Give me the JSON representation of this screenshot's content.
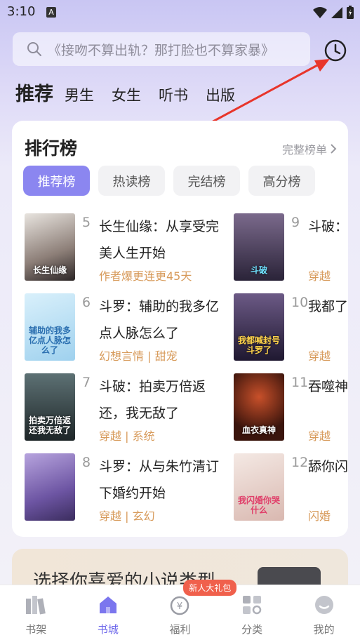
{
  "status": {
    "time": "3:10",
    "a_label": "A"
  },
  "search": {
    "placeholder": "《接吻不算出轨？那打脸也不算家暴》"
  },
  "top_tabs": [
    "推荐",
    "男生",
    "女生",
    "听书",
    "出版"
  ],
  "ranking": {
    "title": "排行榜",
    "more": "完整榜单",
    "chips": [
      "推荐榜",
      "热读榜",
      "完结榜",
      "高分榜"
    ],
    "books_left": [
      {
        "rank": "5",
        "title": "长生仙缘：从享受完美人生开始",
        "tag": "作者爆更连更45天",
        "cover_text": "长生仙缘",
        "cover_color": "#cfc9c2"
      },
      {
        "rank": "6",
        "title": "斗罗：辅助的我多亿点人脉怎么了",
        "tag": "幻想言情 | 甜宠",
        "cover_text": "辅助的我多亿点人脉怎么了",
        "cover_color": "#bfe3f5"
      },
      {
        "rank": "7",
        "title": "斗破：拍卖万倍返还，我无敌了",
        "tag": "穿越 | 系统",
        "cover_text": "拍卖万倍返还我无敌了",
        "cover_color": "#2e3a3c"
      },
      {
        "rank": "8",
        "title": "斗罗：从与朱竹清订下婚约开始",
        "tag": "穿越 | 玄幻",
        "cover_text": "",
        "cover_color": "#8a6fb8"
      }
    ],
    "books_right": [
      {
        "rank": "9",
        "title": "斗破：薰儿",
        "tag": "穿越",
        "cover_text": "斗破",
        "cover_color": "#4a3c5a"
      },
      {
        "rank": "10",
        "title": "我都了，",
        "tag": "穿越",
        "cover_text": "我都喊封号斗罗了",
        "cover_color": "#3b2f4c"
      },
      {
        "rank": "11",
        "title": "吞噬神",
        "tag": "穿越",
        "cover_text": "血衣真神",
        "cover_color": "#3a1a14"
      },
      {
        "rank": "12",
        "title": "舔你闪婚",
        "tag": "闪婚",
        "cover_text": "我闪婚你哭什么",
        "cover_color": "#e9d7d0"
      }
    ]
  },
  "promo": {
    "text": "选择你喜爱的小说类型"
  },
  "bottom_nav": {
    "items": [
      "书架",
      "书城",
      "福利",
      "分类",
      "我的"
    ],
    "gift_badge": "新人大礼包"
  },
  "colors": {
    "accent": "#8b86f0",
    "active_nav": "#6a64ea",
    "tag": "#d79a5a",
    "arrow": "#e8352b"
  }
}
